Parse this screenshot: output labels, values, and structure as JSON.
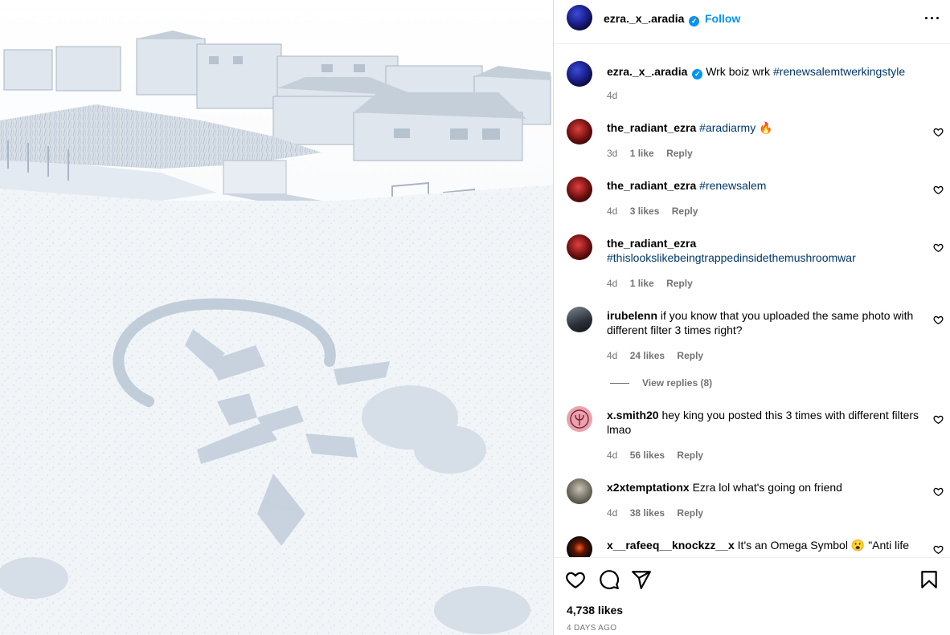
{
  "post": {
    "username": "ezra._x_.aradia",
    "verified": true,
    "follow_label": "Follow",
    "dot": "•",
    "caption": {
      "text": "Wrk boiz wrk",
      "hashtag": "#renewsalemtwerkingstyle",
      "time": "4d"
    },
    "likes": "4,738 likes",
    "date": "4 DAYS AGO"
  },
  "comments": [
    {
      "username": "the_radiant_ezra",
      "text": "",
      "hashtag": "#aradiarmy",
      "emoji": "🔥",
      "time": "3d",
      "likes": "1 like",
      "reply": "Reply"
    },
    {
      "username": "the_radiant_ezra",
      "text": "",
      "hashtag": "#renewsalem",
      "time": "4d",
      "likes": "3 likes",
      "reply": "Reply"
    },
    {
      "username": "the_radiant_ezra",
      "text": "",
      "hashtag": "#thislookslikebeingtrappedinsidethemushroomwar",
      "time": "4d",
      "likes": "1 like",
      "reply": "Reply"
    },
    {
      "username": "irubelenn",
      "text": "if you know that you uploaded the same photo with different filter 3 times right?",
      "time": "4d",
      "likes": "24 likes",
      "reply": "Reply",
      "view_replies": "View replies (8)"
    },
    {
      "username": "x.smith20",
      "text": "hey king you posted this 3 times with different filters lmao",
      "time": "4d",
      "likes": "56 likes",
      "reply": "Reply"
    },
    {
      "username": "x2xtemptationx",
      "text": "Ezra lol what's going on friend",
      "time": "4d",
      "likes": "38 likes",
      "reply": "Reply"
    },
    {
      "username": "x__rafeeq__knockzz__x",
      "text": "It's an Omega Symbol",
      "emoji": "😮",
      "text2": "\"Anti life",
      "time": "",
      "likes": "",
      "reply": ""
    }
  ],
  "icons": {
    "more": "more-options-icon",
    "like": "heart-icon",
    "comment": "comment-icon",
    "share": "send-icon",
    "save": "bookmark-icon",
    "verified": "verified-badge-icon"
  },
  "colors": {
    "accent": "#0095f6",
    "hashtag": "#00376b",
    "muted": "#737373"
  }
}
